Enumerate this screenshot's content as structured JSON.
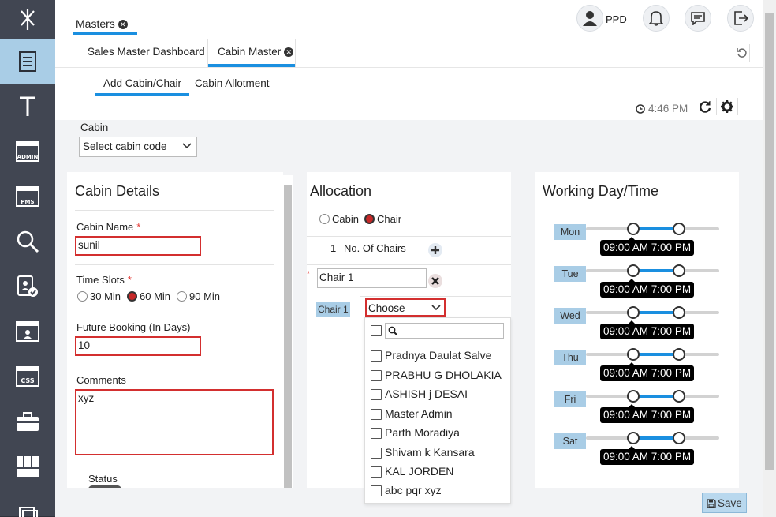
{
  "nav": {
    "items": [
      {
        "name": "logo"
      },
      {
        "name": "masters"
      },
      {
        "name": "text"
      },
      {
        "name": "admin",
        "badge": "ADMIN"
      },
      {
        "name": "pms",
        "badge": "PMS"
      },
      {
        "name": "search"
      },
      {
        "name": "approvals"
      },
      {
        "name": "profile"
      },
      {
        "name": "css",
        "badge": "CSS"
      },
      {
        "name": "briefcase"
      },
      {
        "name": "grid"
      },
      {
        "name": "docs"
      }
    ]
  },
  "header": {
    "tab_label": "Masters",
    "user_name": "PPD"
  },
  "subtabs": {
    "dashboard": "Sales Master Dashboard",
    "cabin_master": "Cabin Master"
  },
  "inner_tabs": {
    "add": "Add Cabin/Chair",
    "allotment": "Cabin Allotment"
  },
  "clock": "4:46 PM",
  "cabin": {
    "label": "Cabin",
    "select_value": "Select cabin code"
  },
  "cabin_details": {
    "title": "Cabin Details",
    "name_label": "Cabin Name",
    "name_value": "sunil",
    "slots_label": "Time Slots",
    "slot_options": [
      "30 Min",
      "60 Min",
      "90 Min"
    ],
    "slot_selected": "60 Min",
    "future_label": "Future Booking (In Days)",
    "future_value": "10",
    "comments_label": "Comments",
    "comments_value": "xyz",
    "status_label": "Status"
  },
  "allocation": {
    "title": "Allocation",
    "type_options": [
      "Cabin",
      "Chair"
    ],
    "type_selected": "Chair",
    "count": "1",
    "count_label": "No. Of Chairs",
    "chair_input": "Chair 1",
    "chair_tag": "Chair 1",
    "choose_placeholder": "Choose",
    "dropdown_options": [
      "Pradnya Daulat Salve",
      "PRABHU G DHOLAKIA",
      "ASHISH j DESAI",
      "Master Admin",
      "Parth Moradiya",
      "Shivam k Kansara",
      "KAL JORDEN",
      "abc pqr xyz"
    ]
  },
  "working": {
    "title": "Working Day/Time",
    "days": [
      {
        "day": "Mon",
        "range": "09:00 AM 7:00 PM"
      },
      {
        "day": "Tue",
        "range": "09:00 AM 7:00 PM"
      },
      {
        "day": "Wed",
        "range": "09:00 AM 7:00 PM"
      },
      {
        "day": "Thu",
        "range": "09:00 AM 7:00 PM"
      },
      {
        "day": "Fri",
        "range": "09:00 AM 7:00 PM"
      },
      {
        "day": "Sat",
        "range": "09:00 AM 7:00 PM"
      }
    ]
  },
  "save_label": "Save",
  "colors": {
    "accent": "#1a8fe0",
    "error": "#d32f2f",
    "rail": "#414652",
    "rail_active": "#a9cde6"
  }
}
